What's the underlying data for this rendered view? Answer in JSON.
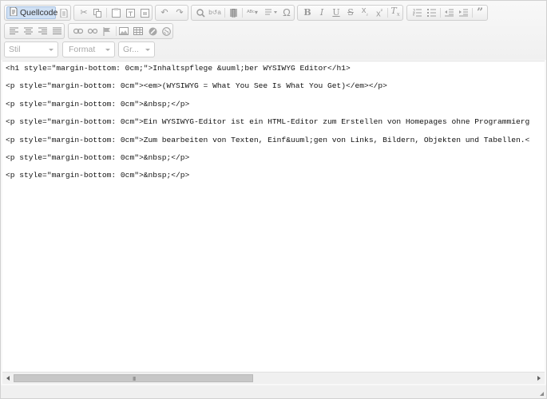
{
  "toolbar": {
    "source_label": "Quellcode",
    "style_combo": "Stil",
    "format_combo": "Format",
    "size_combo": "Gr..."
  },
  "source_lines": [
    "<h1 style=\"margin-bottom: 0cm;\">Inhaltspflege &uuml;ber WYSIWYG Editor</h1>",
    "<p style=\"margin-bottom: 0cm\"><em>(WYSIWYG = What You See Is What You Get)</em></p>",
    "<p style=\"margin-bottom: 0cm\">&nbsp;</p>",
    "<p style=\"margin-bottom: 0cm\">Ein WYSIWYG-Editor ist ein HTML-Editor zum Erstellen von Homepages ohne Programmierg",
    "<p style=\"margin-bottom: 0cm\">Zum bearbeiten von Texten, Einf&uuml;gen von Links, Bildern, Objekten und Tabellen.<",
    "<p style=\"margin-bottom: 0cm\">&nbsp;</p>",
    "<p style=\"margin-bottom: 0cm\">&nbsp;</p>"
  ],
  "scrollbar": {
    "grip": "III"
  },
  "icons": {
    "row1": [
      "source-icon",
      "document-icon",
      "cut-icon",
      "copy-icon",
      "paste-icon",
      "paste-text-icon",
      "paste-word-icon",
      "undo-icon",
      "redo-icon",
      "find-icon",
      "replace-icon",
      "select-all-icon",
      "spellcheck-icon",
      "scayt-icon",
      "special-char-icon",
      "bold-icon",
      "italic-icon",
      "underline-icon",
      "strike-icon",
      "subscript-icon",
      "superscript-icon",
      "remove-format-icon",
      "numbered-list-icon",
      "bulleted-list-icon",
      "outdent-icon",
      "indent-icon",
      "blockquote-icon"
    ],
    "row2": [
      "align-left-icon",
      "align-center-icon",
      "align-right-icon",
      "justify-icon",
      "link-icon",
      "unlink-icon",
      "anchor-icon",
      "image-icon",
      "table-icon",
      "horizontal-rule-icon",
      "iframe-icon"
    ]
  }
}
